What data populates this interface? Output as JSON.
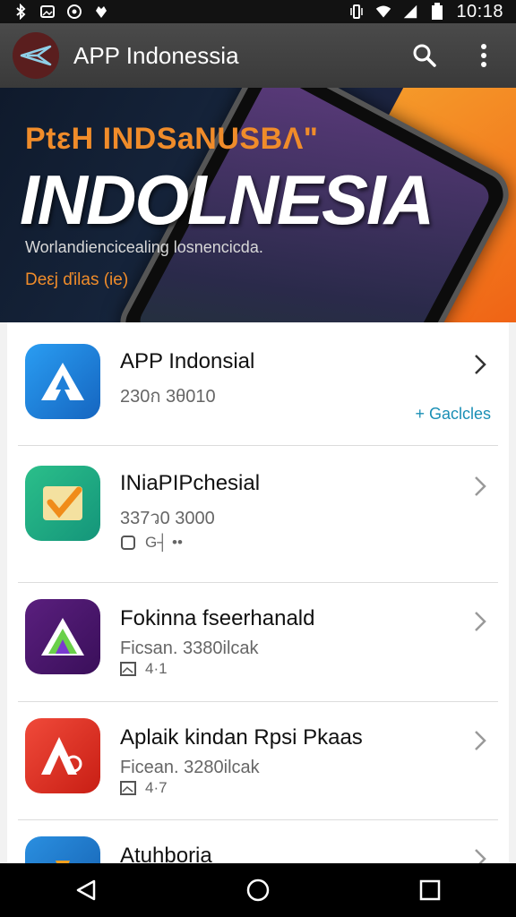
{
  "status_bar": {
    "time": "10:18",
    "left_icons": [
      "bluetooth-icon",
      "photo-icon",
      "sync-icon",
      "notification-icon"
    ],
    "right_icons": [
      "vibrate-icon",
      "wifi-icon",
      "signal-icon",
      "battery-icon"
    ]
  },
  "app_bar": {
    "title": "APP Indonessia",
    "icons": [
      "app-logo-icon",
      "search-icon",
      "more-vert-icon"
    ]
  },
  "banner": {
    "subtitle": "PtεH INDSaNUSBΛ\"",
    "title": "INDOLNESIA",
    "tagline": "Worlandiencicealing losnencicda.",
    "cta": "Deεj ďilas (ie)",
    "colors": {
      "dark": "#17263e",
      "orange": "#ef5b12"
    }
  },
  "apps": [
    {
      "title": "APP Indonsial",
      "meta": "230ก 3θ010",
      "action": "+ Gaclcles",
      "icon": "blue-a-icon",
      "icon_color": "#1e7fd8"
    },
    {
      "title": "INiaPIPchesial",
      "meta": "337ว0 3000",
      "extra": "G┤ ••",
      "icon": "check-tile-icon",
      "icon_color": "#1ea886"
    },
    {
      "title": "Fokinna fseerhanald",
      "meta": "Ficsan. 3380ilcak",
      "extra": "4·1",
      "icon": "purple-a-icon",
      "icon_color": "#4a1a6e"
    },
    {
      "title": "Aplaik kindan Rpsi Pkaas",
      "meta": "Ficean. 3280ilcak",
      "extra": "4·7",
      "icon": "red-a-icon",
      "icon_color": "#e8392e"
    },
    {
      "title": "Atuhboria",
      "icon": "blue-partial-icon",
      "icon_color": "#1a7fc8"
    }
  ],
  "nav_bar": {
    "buttons": [
      "back-icon",
      "home-icon",
      "recents-icon"
    ]
  }
}
